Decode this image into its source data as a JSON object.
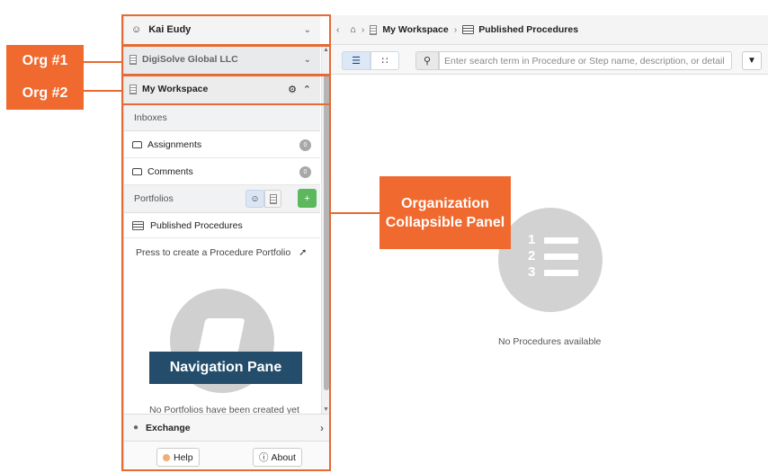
{
  "user": {
    "name": "Kai Eudy"
  },
  "orgs": [
    {
      "name": "DigiSolve Global LLC"
    },
    {
      "name": "My Workspace"
    }
  ],
  "nav": {
    "inboxes_label": "Inboxes",
    "inboxes": [
      {
        "label": "Assignments",
        "count": "0"
      },
      {
        "label": "Comments",
        "count": "0"
      }
    ],
    "portfolios_label": "Portfolios",
    "published_label": "Published Procedures",
    "create_hint": "Press to create a Procedure Portfolio",
    "empty_text": "No Portfolios have been created yet",
    "exchange_label": "Exchange",
    "help_label": "Help",
    "about_label": "About"
  },
  "breadcrumb": {
    "workspace": "My Workspace",
    "page": "Published Procedures"
  },
  "search": {
    "placeholder": "Enter search term in Procedure or Step name, description, or detail"
  },
  "main": {
    "empty_text": "No Procedures available",
    "icon_numbers": [
      "1",
      "2",
      "3"
    ]
  },
  "annotations": {
    "org1": "Org #1",
    "org2": "Org #2",
    "collapsible_panel": "Organization Collapsible Panel",
    "nav_pane": "Navigation Pane",
    "accent_color": "#f0692f",
    "nav_label_color": "#234d6b"
  }
}
